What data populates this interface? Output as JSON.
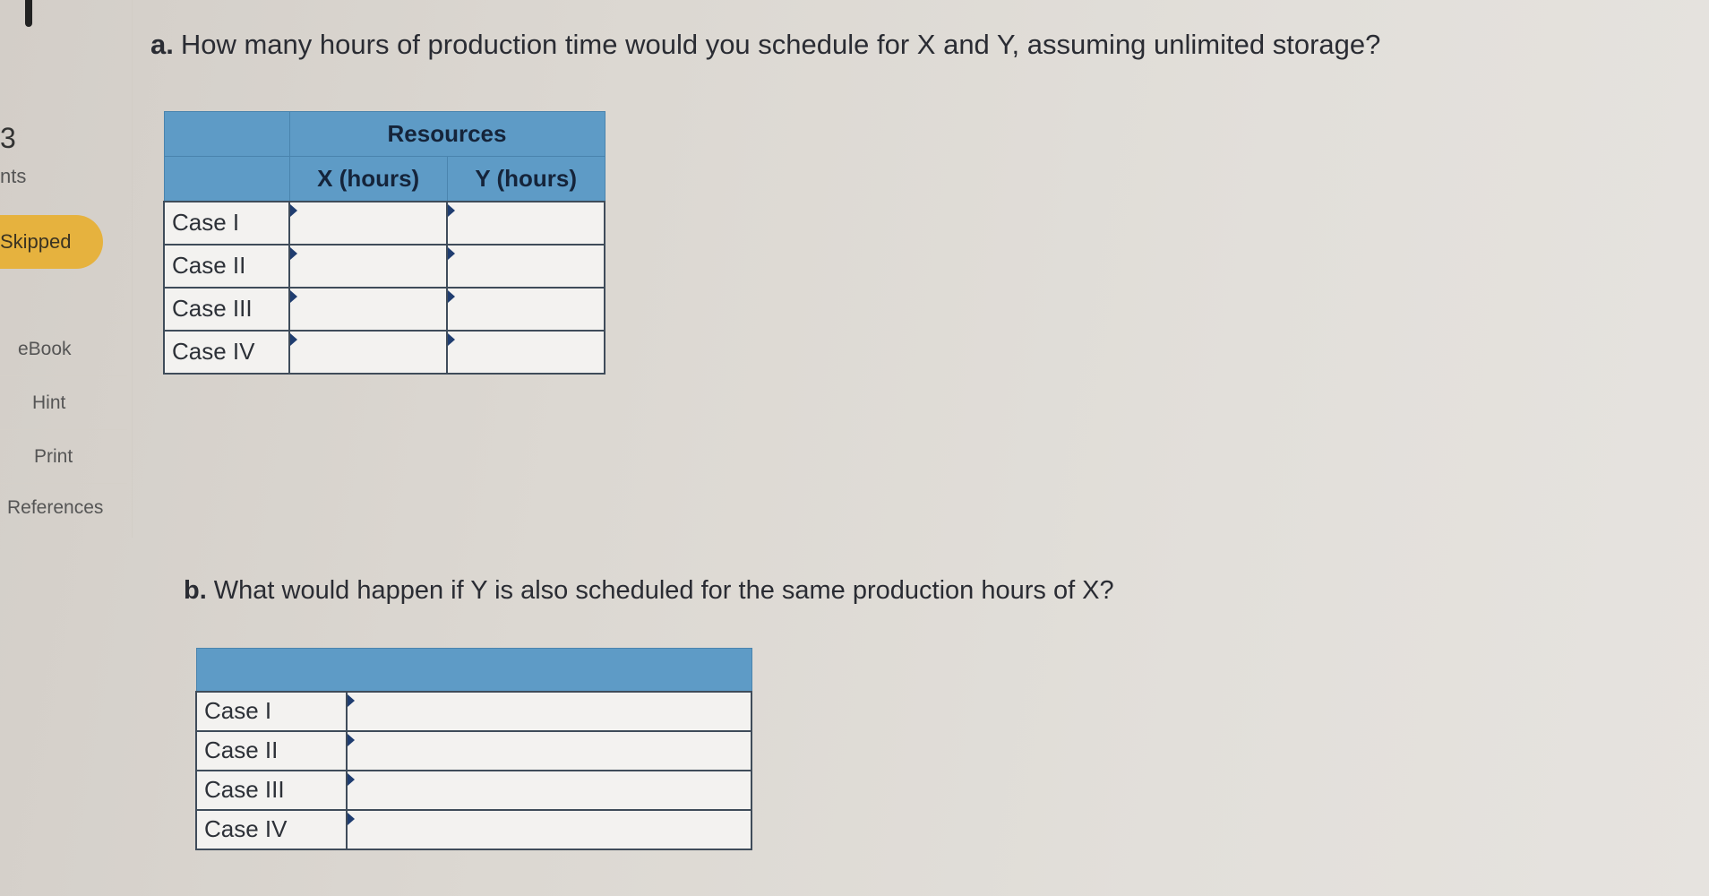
{
  "sidebar": {
    "question_number": "3",
    "points_label": "nts",
    "status_badge": "Skipped",
    "links": [
      "eBook",
      "Hint",
      "Print",
      "References"
    ]
  },
  "part_a": {
    "letter": "a.",
    "question": "How many hours of production time would you schedule for X and Y, assuming unlimited storage?",
    "table": {
      "group_header": "Resources",
      "columns": [
        "",
        "X (hours)",
        "Y (hours)"
      ],
      "rows": [
        {
          "label": "Case I",
          "x": "",
          "y": ""
        },
        {
          "label": "Case II",
          "x": "",
          "y": ""
        },
        {
          "label": "Case III",
          "x": "",
          "y": ""
        },
        {
          "label": "Case IV",
          "x": "",
          "y": ""
        }
      ]
    }
  },
  "part_b": {
    "letter": "b.",
    "question": "What would happen if Y is also scheduled for the same production hours of X?",
    "table": {
      "rows": [
        {
          "label": "Case I",
          "answer": ""
        },
        {
          "label": "Case II",
          "answer": ""
        },
        {
          "label": "Case III",
          "answer": ""
        },
        {
          "label": "Case IV",
          "answer": ""
        }
      ]
    }
  }
}
